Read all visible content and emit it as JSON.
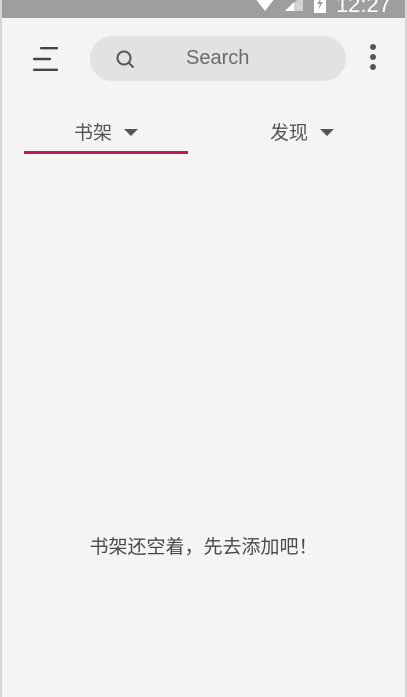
{
  "status_bar": {
    "time": "12:27",
    "icons": [
      "wifi-icon",
      "signal-icon",
      "battery-icon"
    ]
  },
  "toolbar": {
    "menu_icon": "menu-icon",
    "search": {
      "placeholder": "Search",
      "icon": "search-icon"
    },
    "overflow_icon": "more-vert-icon"
  },
  "tabs": [
    {
      "label": "书架",
      "icon": "dropdown-icon",
      "selected": true
    },
    {
      "label": "发现",
      "icon": "dropdown-icon",
      "selected": false
    }
  ],
  "main": {
    "empty_message": "书架还空着，先去添加吧！"
  },
  "colors": {
    "accent": "#c2185b",
    "background": "#f4f4f4",
    "search_bg": "#e2e2e2",
    "status_bar": "#9e9e9e"
  }
}
